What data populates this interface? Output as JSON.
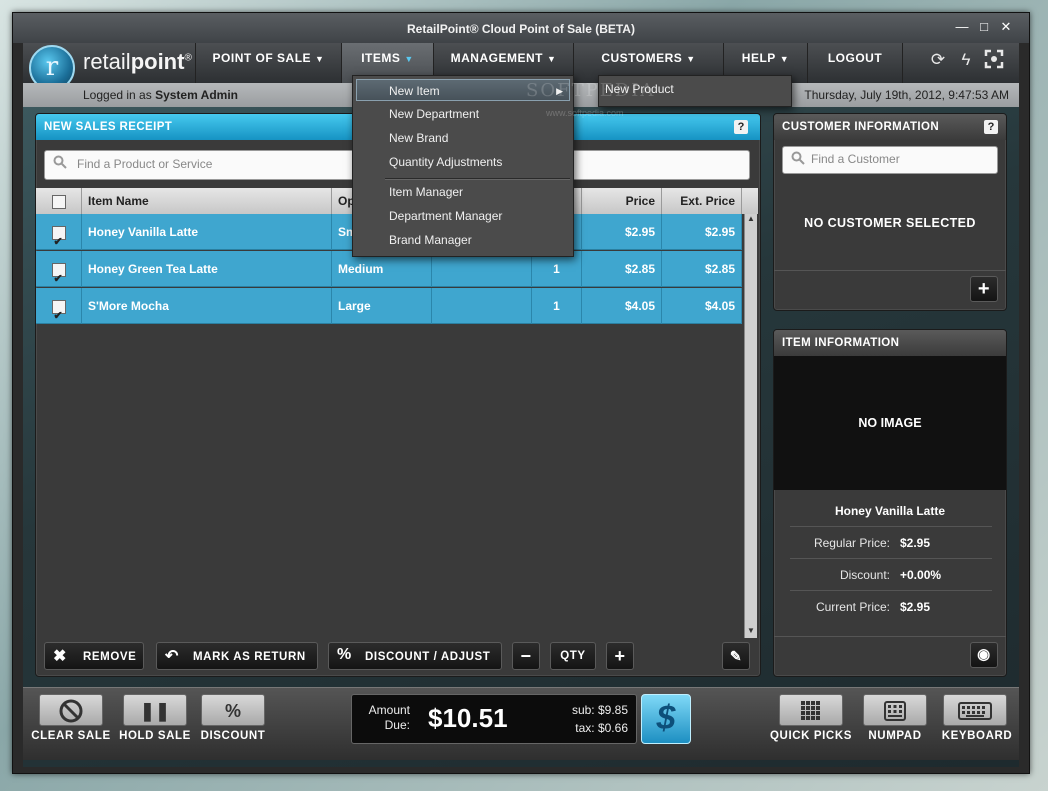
{
  "window": {
    "title": "RetailPoint® Cloud Point of Sale (BETA)",
    "controls": {
      "minimize": "—",
      "maximize": "□",
      "close": "✕"
    }
  },
  "brand": {
    "logo_letter": "r",
    "name_part1": "retail",
    "name_part2": "point",
    "reg": "®"
  },
  "nav": {
    "menus": [
      "POINT OF SALE",
      "ITEMS",
      "MANAGEMENT",
      "CUSTOMERS",
      "HELP",
      "LOGOUT"
    ],
    "active_menu": "ITEMS",
    "tool_icons": [
      "sync-icon",
      "lightning-icon",
      "fullscreen-icon"
    ]
  },
  "infobar": {
    "logged_prefix": "Logged in as",
    "user": "System Admin",
    "datetime": "Thursday, July 19th, 2012, 9:47:53 AM"
  },
  "items_menu": {
    "items": [
      "New Item",
      "New Department",
      "New Brand",
      "Quantity Adjustments",
      "Item Manager",
      "Department Manager",
      "Brand Manager"
    ],
    "highlighted": "New Item",
    "submenu": [
      "New Product"
    ]
  },
  "watermark": {
    "text": "SOFTPEDIA",
    "url": "www.softpedia.com"
  },
  "receipt": {
    "title": "NEW SALES RECEIPT",
    "help": "?",
    "search_placeholder": "Find a Product or Service",
    "columns": [
      "",
      "Item Name",
      "Op",
      "",
      "",
      "Price",
      "Ext. Price"
    ],
    "rows": [
      {
        "checked": true,
        "name": "Honey Vanilla Latte",
        "option": "Sm",
        "qty": "",
        "price": "$2.95",
        "ext": "$2.95"
      },
      {
        "checked": true,
        "name": "Honey Green Tea Latte",
        "option": "Medium",
        "qty": "1",
        "price": "$2.85",
        "ext": "$2.85"
      },
      {
        "checked": true,
        "name": "S'More Mocha",
        "option": "Large",
        "qty": "1",
        "price": "$4.05",
        "ext": "$4.05"
      }
    ],
    "actions": {
      "remove": "REMOVE",
      "mark_return": "MARK AS RETURN",
      "discount_adjust": "DISCOUNT / ADJUST",
      "qty": "QTY"
    }
  },
  "customer": {
    "title": "CUSTOMER INFORMATION",
    "help": "?",
    "search_placeholder": "Find a Customer",
    "empty_text": "NO CUSTOMER SELECTED"
  },
  "item_info": {
    "title": "ITEM INFORMATION",
    "no_image": "NO IMAGE",
    "item_name": "Honey Vanilla Latte",
    "regular_price_label": "Regular Price:",
    "regular_price": "$2.95",
    "discount_label": "Discount:",
    "discount": "+0.00%",
    "current_price_label": "Current Price:",
    "current_price": "$2.95"
  },
  "footer": {
    "clear_sale": "CLEAR SALE",
    "hold_sale": "HOLD SALE",
    "discount": "DISCOUNT",
    "discount_symbol": "%",
    "amount_label_1": "Amount",
    "amount_label_2": "Due:",
    "amount_due": "$10.51",
    "sub_label": "sub: $9.85",
    "tax_label": "tax: $0.66",
    "pay_symbol": "$",
    "quick_picks": "QUICK PICKS",
    "numpad": "NUMPAD",
    "keyboard": "KEYBOARD"
  },
  "colors": {
    "accent": "#2aa9d8",
    "row_bg": "#3fa6cf"
  }
}
